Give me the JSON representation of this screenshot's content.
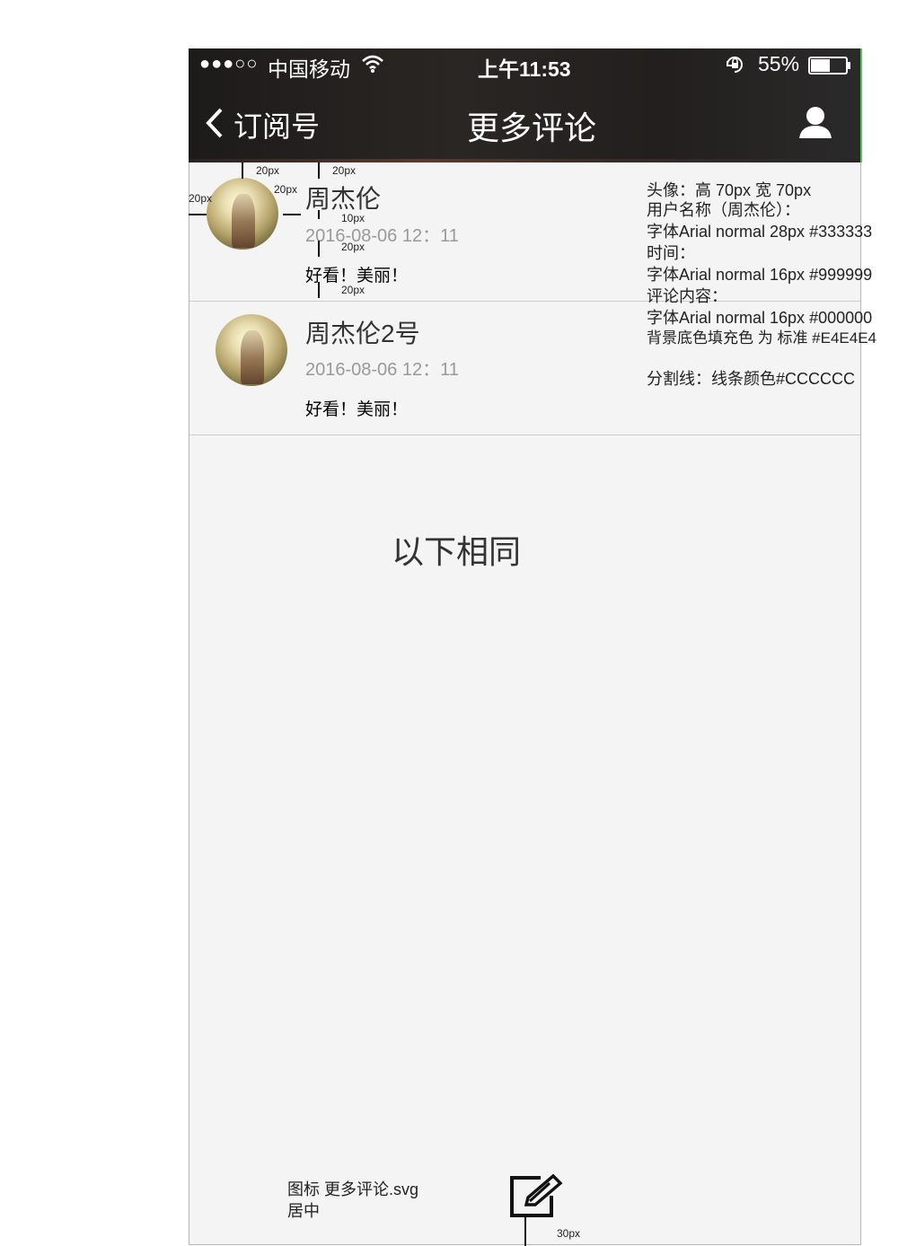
{
  "status_bar": {
    "signal": "●●●○○",
    "carrier": "中国移动",
    "time": "上午11:53",
    "battery": "55%",
    "battery_level": 0.55
  },
  "nav": {
    "back_label": "订阅号",
    "title": "更多评论"
  },
  "comments": [
    {
      "name": "周杰伦",
      "time": "2016-08-06 12：11",
      "content": "好看！美丽！"
    },
    {
      "name": "周杰伦2号",
      "time": "2016-08-06 12：11",
      "content": "好看！美丽！"
    }
  ],
  "placeholder": "以下相同",
  "dimensions": {
    "d1": "20px",
    "d2": "20px",
    "d3": "20px",
    "d4": "20px",
    "d5": "10px",
    "d6": "20px",
    "d7": "20px",
    "d8": "30px"
  },
  "annotations": {
    "avatar_size": "头像：高 70px 宽 70px",
    "username_label": "用户名称（周杰伦）：",
    "username_font": "字体Arial normal 28px #333333",
    "time_label": "时间：",
    "time_font": "字体Arial normal 16px #999999",
    "content_label": "评论内容：",
    "content_font": "字体Arial normal 16px #000000",
    "background": "背景底色填充色 为 标准 #E4E4E4",
    "divider": "分割线：线条颜色#CCCCCC",
    "icon_note_1": "图标 更多评论.svg",
    "icon_note_2": "居中"
  },
  "colors": {
    "name": "#333333",
    "time": "#999999",
    "content": "#000000",
    "divider": "#CCCCCC",
    "background": "#F4F4F4"
  }
}
